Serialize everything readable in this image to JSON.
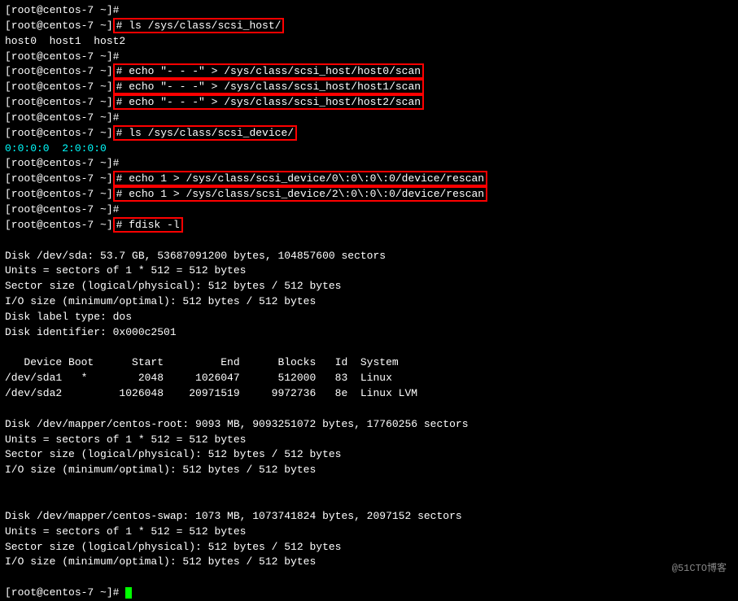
{
  "terminal": {
    "lines": [
      {
        "type": "prompt",
        "text": "[root@centos-7 ~]#"
      },
      {
        "type": "prompt-cmd-highlight",
        "before": "[root@centos-7 ~]",
        "cmd": "# ls /sys/class/scsi_host/",
        "after": ""
      },
      {
        "type": "output",
        "text": "host0  host1  host2"
      },
      {
        "type": "prompt",
        "text": "[root@centos-7 ~]#"
      },
      {
        "type": "prompt-cmd-highlight",
        "before": "[root@centos-7 ~]",
        "cmd": "# echo \"- - -\" > /sys/class/scsi_host/host0/scan",
        "after": ""
      },
      {
        "type": "prompt-cmd-highlight",
        "before": "[root@centos-7 ~]",
        "cmd": "# echo \"- - -\" > /sys/class/scsi_host/host1/scan",
        "after": ""
      },
      {
        "type": "prompt-cmd-highlight",
        "before": "[root@centos-7 ~]",
        "cmd": "# echo \"- - -\" > /sys/class/scsi_host/host2/scan",
        "after": ""
      },
      {
        "type": "prompt",
        "text": "[root@centos-7 ~]#"
      },
      {
        "type": "prompt-cmd-highlight",
        "before": "[root@centos-7 ~]",
        "cmd": "# ls /sys/class/scsi_device/",
        "after": ""
      },
      {
        "type": "output-cyan",
        "text": "0:0:0:0  2:0:0:0"
      },
      {
        "type": "prompt",
        "text": "[root@centos-7 ~]#"
      },
      {
        "type": "prompt-cmd-highlight",
        "before": "[root@centos-7 ~]",
        "cmd": "# echo 1 > /sys/class/scsi_device/0\\:0\\:0\\:0/device/rescan",
        "after": ""
      },
      {
        "type": "prompt-cmd-highlight",
        "before": "[root@centos-7 ~]",
        "cmd": "# echo 1 > /sys/class/scsi_device/2\\:0\\:0\\:0/device/rescan",
        "after": ""
      },
      {
        "type": "prompt",
        "text": "[root@centos-7 ~]#"
      },
      {
        "type": "prompt-cmd-highlight",
        "before": "[root@centos-7 ~]",
        "cmd": "# fdisk -l",
        "after": ""
      },
      {
        "type": "blank"
      },
      {
        "type": "output",
        "text": "Disk /dev/sda: 53.7 GB, 53687091200 bytes, 104857600 sectors"
      },
      {
        "type": "output",
        "text": "Units = sectors of 1 * 512 = 512 bytes"
      },
      {
        "type": "output",
        "text": "Sector size (logical/physical): 512 bytes / 512 bytes"
      },
      {
        "type": "output",
        "text": "I/O size (minimum/optimal): 512 bytes / 512 bytes"
      },
      {
        "type": "output",
        "text": "Disk label type: dos"
      },
      {
        "type": "output",
        "text": "Disk identifier: 0x000c2501"
      },
      {
        "type": "blank"
      },
      {
        "type": "output",
        "text": "   Device Boot      Start         End      Blocks   Id  System"
      },
      {
        "type": "output",
        "text": "/dev/sda1   *        2048     1026047      512000   83  Linux"
      },
      {
        "type": "output",
        "text": "/dev/sda2         1026048    20971519     9972736   8e  Linux LVM"
      },
      {
        "type": "blank"
      },
      {
        "type": "output",
        "text": "Disk /dev/mapper/centos-root: 9093 MB, 9093251072 bytes, 17760256 sectors"
      },
      {
        "type": "output",
        "text": "Units = sectors of 1 * 512 = 512 bytes"
      },
      {
        "type": "output",
        "text": "Sector size (logical/physical): 512 bytes / 512 bytes"
      },
      {
        "type": "output",
        "text": "I/O size (minimum/optimal): 512 bytes / 512 bytes"
      },
      {
        "type": "blank"
      },
      {
        "type": "blank"
      },
      {
        "type": "output",
        "text": "Disk /dev/mapper/centos-swap: 1073 MB, 1073741824 bytes, 2097152 sectors"
      },
      {
        "type": "output",
        "text": "Units = sectors of 1 * 512 = 512 bytes"
      },
      {
        "type": "output",
        "text": "Sector size (logical/physical): 512 bytes / 512 bytes"
      },
      {
        "type": "output",
        "text": "I/O size (minimum/optimal): 512 bytes / 512 bytes"
      },
      {
        "type": "blank"
      },
      {
        "type": "prompt-cursor",
        "text": "[root@centos-7 ~]# "
      }
    ],
    "watermark": "@51CTO博客"
  }
}
